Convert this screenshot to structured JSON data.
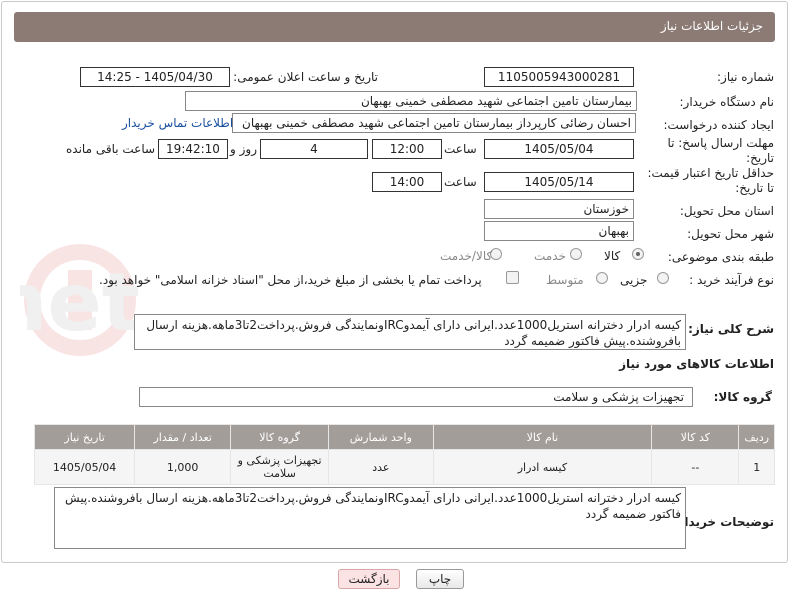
{
  "header": {
    "title": "جزئیات اطلاعات نیاز"
  },
  "fields": {
    "need_number_label": "شماره نیاز:",
    "need_number": "1105005943000281",
    "announce_label": "تاریخ و ساعت اعلان عمومی:",
    "announce_value": "1405/04/30 - 14:25",
    "buyer_org_label": "نام دستگاه خریدار:",
    "buyer_org": "بیمارستان تامین اجتماعی شهید مصطفی خمینی بهبهان",
    "creator_label": "ایجاد کننده درخواست:",
    "creator": "احسان رضائی کارپرداز بیمارستان تامین اجتماعی شهید مصطفی خمینی بهبهان",
    "contact_link": "اطلاعات تماس خریدار",
    "deadline_label_1": "مهلت ارسال پاسخ: تا",
    "deadline_label_2": "تاریخ:",
    "deadline_date": "1405/05/04",
    "time_label": "ساعت",
    "deadline_time": "12:00",
    "days_value": "4",
    "days_label": "روز و",
    "remaining_time": "19:42:10",
    "remaining_label": "ساعت باقی مانده",
    "validity_label_1": "حداقل تاریخ اعتبار قیمت:",
    "validity_label_2": "تا تاریخ:",
    "validity_date": "1405/05/14",
    "validity_time_label": "ساعت",
    "validity_time": "14:00",
    "province_label": "استان محل تحویل:",
    "province": "خوزستان",
    "city_label": "شهر محل تحویل:",
    "city": "بهبهان",
    "category_label": "طبقه بندی موضوعی:",
    "category_options": [
      "کالا",
      "خدمت",
      "کالا/خدمت"
    ],
    "purchase_type_label": "نوع فرآیند خرید :",
    "purchase_options": [
      "جزیی",
      "متوسط"
    ],
    "payment_text": "پرداخت تمام یا بخشی از مبلغ خرید،از محل \"اسناد خزانه اسلامی\" خواهد بود."
  },
  "description": {
    "label": "شرح کلی نیاز:",
    "text": "کیسه ادرار دخترانه استریل1000عدد.ایرانی دارای آیمدوIRCونمایندگی فروش.پرداخت2تا3ماهه.هزینه ارسال بافروشنده.پیش فاکتور ضمیمه گردد"
  },
  "goods": {
    "section_title": "اطلاعات کالاهای مورد نیاز",
    "group_label": "گروه کالا:",
    "group_value": "تجهیزات پزشکی و سلامت",
    "columns": [
      "ردیف",
      "کد کالا",
      "نام کالا",
      "واحد شمارش",
      "گروه کالا",
      "تعداد / مقدار",
      "تاریخ نیاز"
    ],
    "rows": [
      {
        "row": "1",
        "code": "--",
        "name": "کیسه ادرار",
        "unit": "عدد",
        "group": "تجهیزات پزشکی و سلامت",
        "qty": "1,000",
        "date": "1405/05/04"
      }
    ]
  },
  "buyer_notes": {
    "label": "توضیحات خریدار:",
    "text": "کیسه ادرار دخترانه استریل1000عدد.ایرانی دارای آیمدوIRCونمایندگی فروش.پرداخت2تا3ماهه.هزینه ارسال بافروشنده.پیش فاکتور ضمیمه گردد"
  },
  "buttons": {
    "print": "چاپ",
    "back": "بازگشت"
  },
  "colors": {
    "header_bg": "#8c7a75",
    "table_header_bg": "#a39d9a",
    "link": "#1a4fa0"
  }
}
